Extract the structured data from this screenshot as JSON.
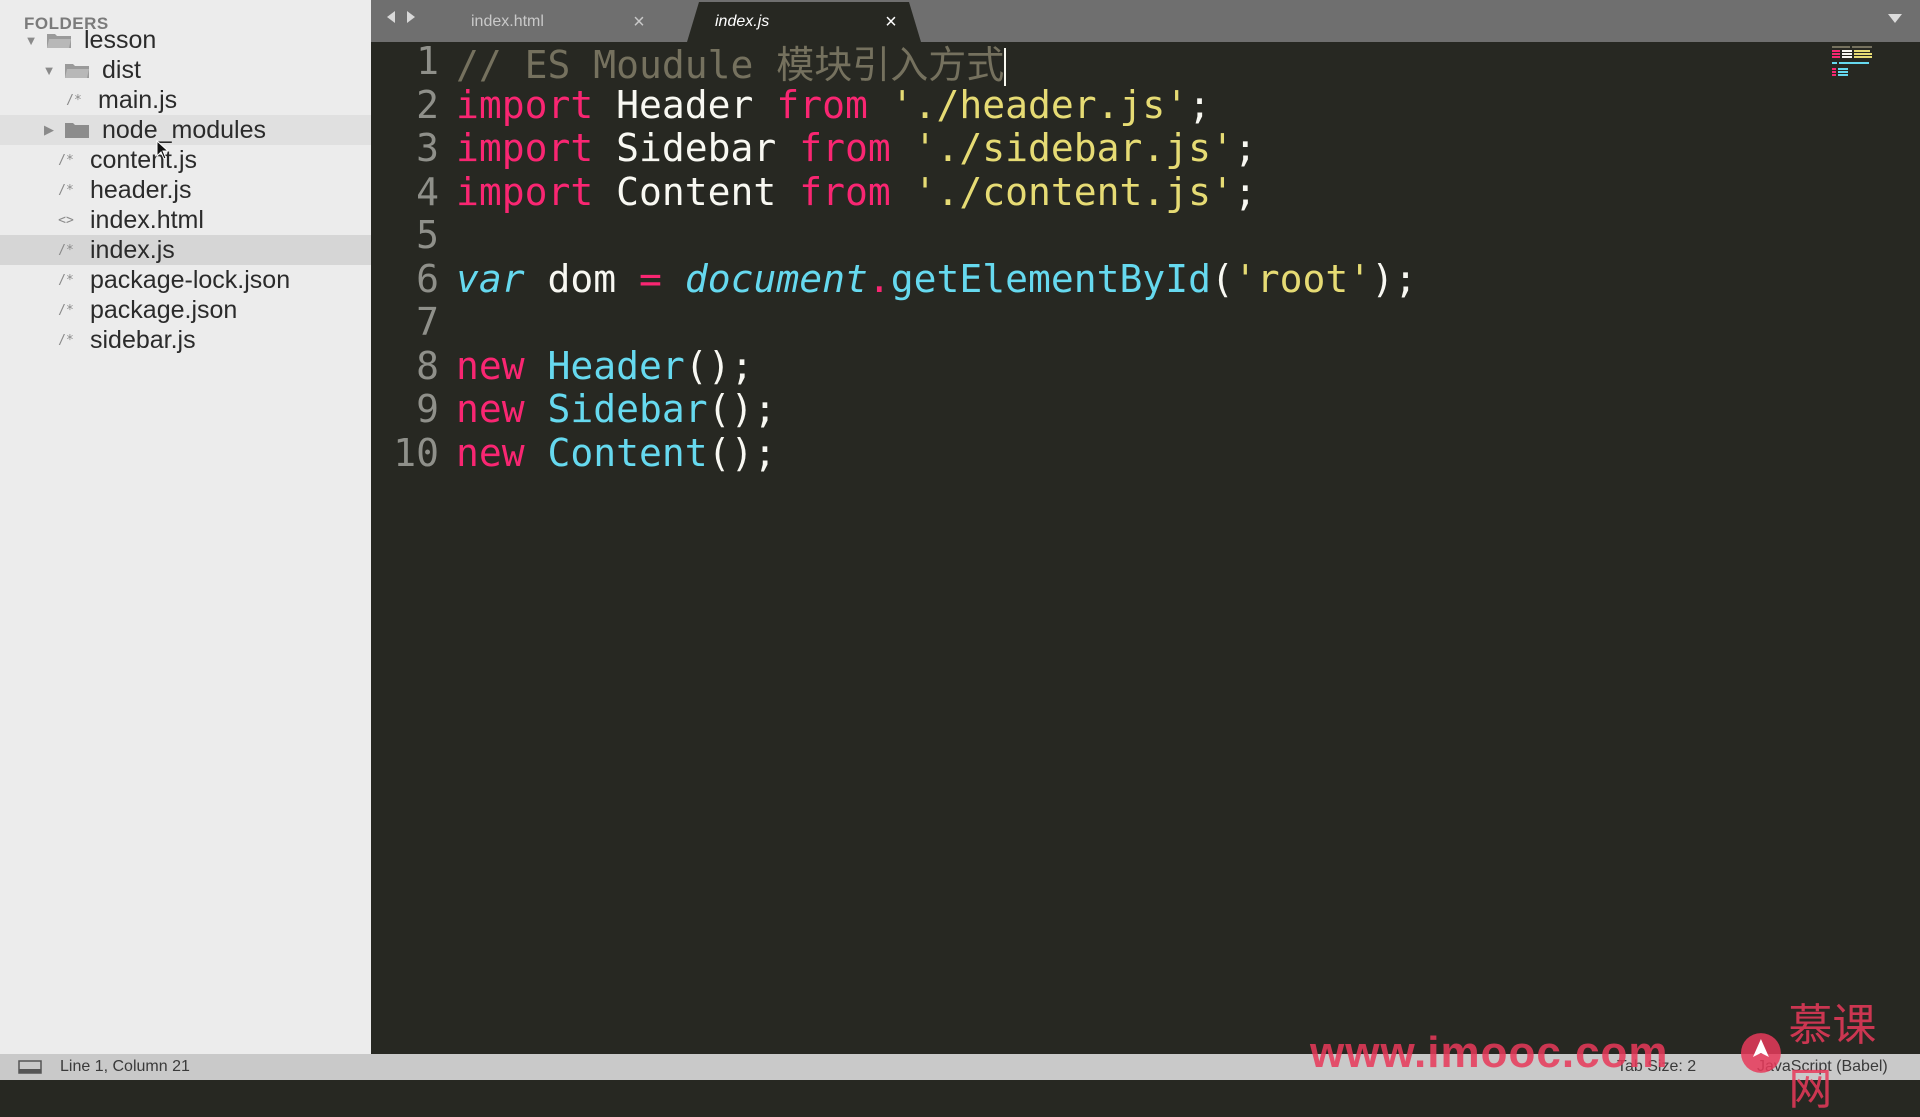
{
  "sidebar": {
    "heading": "FOLDERS",
    "tree": [
      {
        "label": "lesson",
        "kind": "folder",
        "expanded": true
      },
      {
        "label": "dist",
        "kind": "folder",
        "expanded": true
      },
      {
        "label": "main.js",
        "kind": "file",
        "icon": "/*"
      },
      {
        "label": "node_modules",
        "kind": "folder",
        "expanded": false
      },
      {
        "label": "content.js",
        "kind": "file",
        "icon": "/*"
      },
      {
        "label": "header.js",
        "kind": "file",
        "icon": "/*"
      },
      {
        "label": "index.html",
        "kind": "file",
        "icon": "<>"
      },
      {
        "label": "index.js",
        "kind": "file",
        "icon": "/*"
      },
      {
        "label": "package-lock.json",
        "kind": "file",
        "icon": "/*"
      },
      {
        "label": "package.json",
        "kind": "file",
        "icon": "/*"
      },
      {
        "label": "sidebar.js",
        "kind": "file",
        "icon": "/*"
      }
    ]
  },
  "tabs": [
    {
      "label": "index.html",
      "active": false,
      "close": "×"
    },
    {
      "label": "index.js",
      "active": true,
      "close": "×"
    }
  ],
  "editor": {
    "lines": [
      {
        "num": "1",
        "tokens": [
          {
            "t": "comment",
            "v": "// ES Moudule 模块引入方式"
          }
        ]
      },
      {
        "num": "2",
        "tokens": [
          {
            "t": "kw",
            "v": "import"
          },
          {
            "t": "plain",
            "v": " Header "
          },
          {
            "t": "kw",
            "v": "from"
          },
          {
            "t": "plain",
            "v": " "
          },
          {
            "t": "str",
            "v": "'./header.js'"
          },
          {
            "t": "plain",
            "v": ";"
          }
        ]
      },
      {
        "num": "3",
        "tokens": [
          {
            "t": "kw",
            "v": "import"
          },
          {
            "t": "plain",
            "v": " Sidebar "
          },
          {
            "t": "kw",
            "v": "from"
          },
          {
            "t": "plain",
            "v": " "
          },
          {
            "t": "str",
            "v": "'./sidebar.js'"
          },
          {
            "t": "plain",
            "v": ";"
          }
        ]
      },
      {
        "num": "4",
        "tokens": [
          {
            "t": "kw",
            "v": "import"
          },
          {
            "t": "plain",
            "v": " Content "
          },
          {
            "t": "kw",
            "v": "from"
          },
          {
            "t": "plain",
            "v": " "
          },
          {
            "t": "str",
            "v": "'./content.js'"
          },
          {
            "t": "plain",
            "v": ";"
          }
        ]
      },
      {
        "num": "5",
        "tokens": []
      },
      {
        "num": "6",
        "tokens": [
          {
            "t": "storage",
            "v": "var"
          },
          {
            "t": "plain",
            "v": " dom "
          },
          {
            "t": "op",
            "v": "="
          },
          {
            "t": "plain",
            "v": " "
          },
          {
            "t": "support",
            "v": "document"
          },
          {
            "t": "op",
            "v": "."
          },
          {
            "t": "func",
            "v": "getElementById"
          },
          {
            "t": "plain",
            "v": "("
          },
          {
            "t": "str",
            "v": "'root'"
          },
          {
            "t": "plain",
            "v": ");"
          }
        ]
      },
      {
        "num": "7",
        "tokens": []
      },
      {
        "num": "8",
        "tokens": [
          {
            "t": "kw",
            "v": "new"
          },
          {
            "t": "plain",
            "v": " "
          },
          {
            "t": "func",
            "v": "Header"
          },
          {
            "t": "plain",
            "v": "();"
          }
        ]
      },
      {
        "num": "9",
        "tokens": [
          {
            "t": "kw",
            "v": "new"
          },
          {
            "t": "plain",
            "v": " "
          },
          {
            "t": "func",
            "v": "Sidebar"
          },
          {
            "t": "plain",
            "v": "();"
          }
        ]
      },
      {
        "num": "10",
        "tokens": [
          {
            "t": "kw",
            "v": "new"
          },
          {
            "t": "plain",
            "v": " "
          },
          {
            "t": "func",
            "v": "Content"
          },
          {
            "t": "plain",
            "v": "();"
          }
        ]
      }
    ]
  },
  "statusbar": {
    "position": "Line 1, Column 21",
    "tab_size": "Tab Size: 2",
    "syntax": "JavaScript (Babel)"
  },
  "watermark": {
    "url": "www.imooc.com",
    "brand": "慕课网"
  },
  "colors": {
    "keyword": "#f92672",
    "string": "#e6db74",
    "function": "#66d9ef",
    "comment": "#75715e",
    "editor_bg": "#272822",
    "sidebar_bg": "#ececec"
  }
}
